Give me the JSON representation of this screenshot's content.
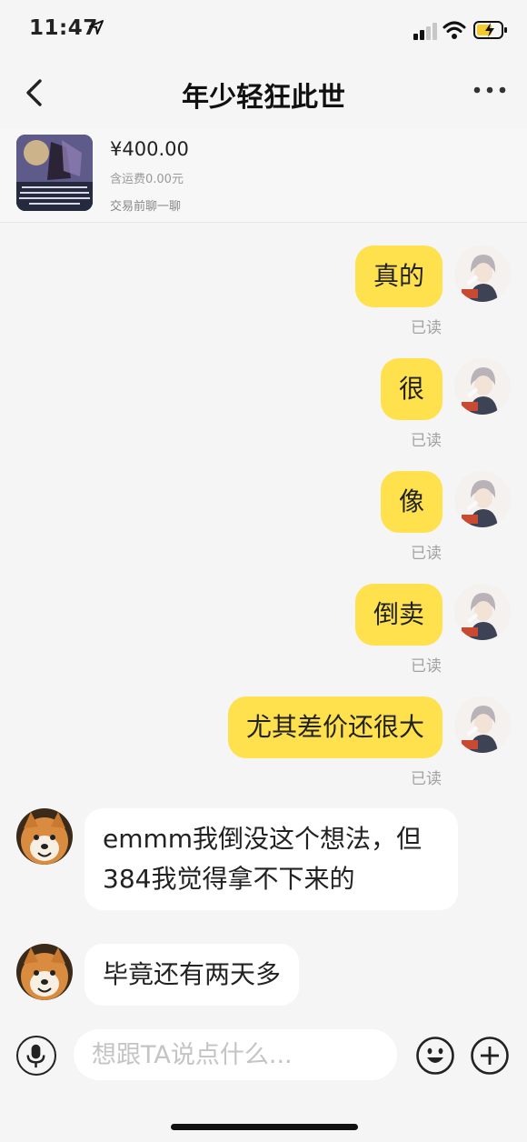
{
  "status_bar": {
    "time": "11:47"
  },
  "header": {
    "title": "年少轻狂此世"
  },
  "product": {
    "price": "¥400.00",
    "shipping": "含运费0.00元",
    "hint": "交易前聊一聊"
  },
  "messages": [
    {
      "sender": "me",
      "text": "真的",
      "status": "已读"
    },
    {
      "sender": "me",
      "text": "很",
      "status": "已读"
    },
    {
      "sender": "me",
      "text": "像",
      "status": "已读"
    },
    {
      "sender": "me",
      "text": "倒卖",
      "status": "已读"
    },
    {
      "sender": "me",
      "text": "尤其差价还很大",
      "status": "已读"
    },
    {
      "sender": "other",
      "text_line1": "emmm我倒没这个想法，但",
      "text_line2": "384我觉得拿不下来的"
    },
    {
      "sender": "other",
      "text": "毕竟还有两天多"
    }
  ],
  "input": {
    "placeholder": "想跟TA说点什么..."
  },
  "colors": {
    "bubble_me": "#ffe14d",
    "bubble_other": "#ffffff",
    "background": "#f5f5f5"
  },
  "icons": [
    "location-arrow-icon",
    "signal-icon",
    "wifi-icon",
    "battery-charging-icon",
    "back-chevron-icon",
    "more-dots-icon",
    "mic-icon",
    "emoji-icon",
    "plus-icon"
  ]
}
